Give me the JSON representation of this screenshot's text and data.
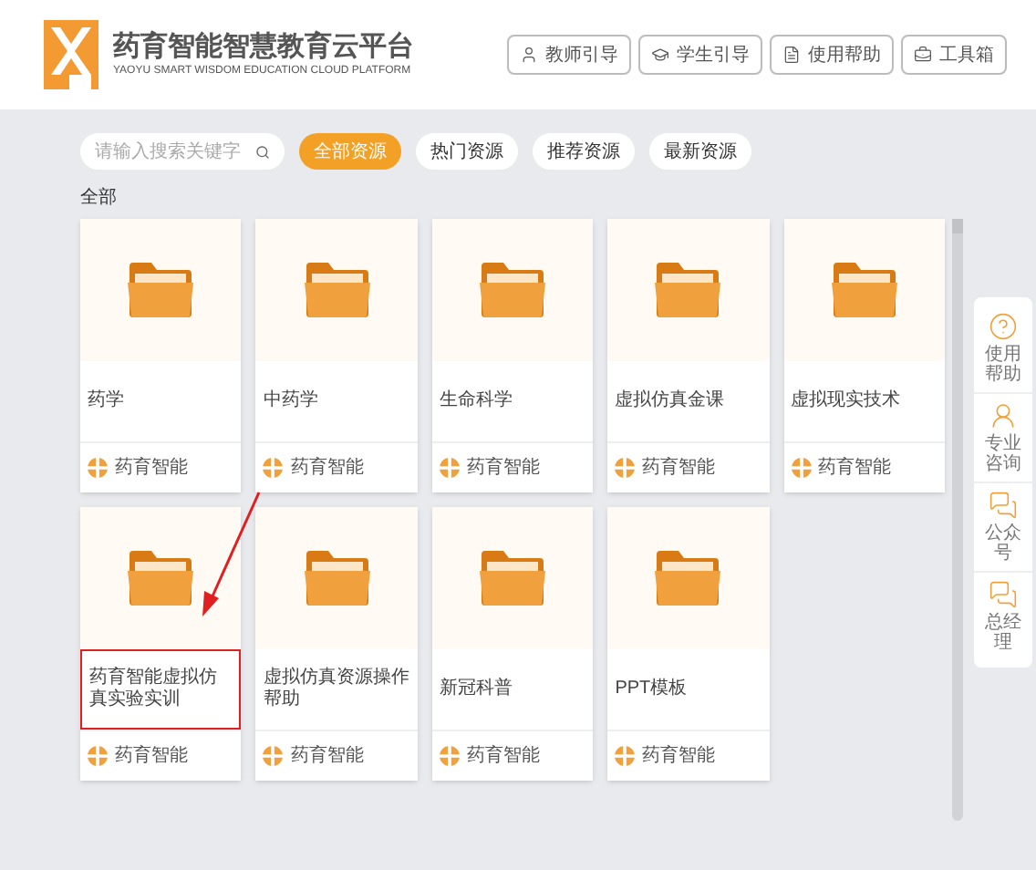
{
  "header": {
    "title": "药育智能智慧教育云平台",
    "subtitle": "YAOYU SMART WISDOM EDUCATION CLOUD PLATFORM",
    "buttons": [
      {
        "label": "教师引导"
      },
      {
        "label": "学生引导"
      },
      {
        "label": "使用帮助"
      },
      {
        "label": "工具箱"
      }
    ]
  },
  "search": {
    "placeholder": "请输入搜索关键字"
  },
  "filters": [
    {
      "label": "全部资源",
      "selected": true
    },
    {
      "label": "热门资源",
      "selected": false
    },
    {
      "label": "推荐资源",
      "selected": false
    },
    {
      "label": "最新资源",
      "selected": false
    }
  ],
  "section_title": "全部",
  "cards": [
    {
      "title": "药学",
      "author": "药育智能",
      "highlighted": false
    },
    {
      "title": "中药学",
      "author": "药育智能",
      "highlighted": false
    },
    {
      "title": "生命科学",
      "author": "药育智能",
      "highlighted": false
    },
    {
      "title": "虚拟仿真金课",
      "author": "药育智能",
      "highlighted": false
    },
    {
      "title": "虚拟现实技术",
      "author": "药育智能",
      "highlighted": false
    },
    {
      "title": "药育智能虚拟仿真实验实训",
      "author": "药育智能",
      "highlighted": true
    },
    {
      "title": "虚拟仿真资源操作帮助",
      "author": "药育智能",
      "highlighted": false
    },
    {
      "title": "新冠科普",
      "author": "药育智能",
      "highlighted": false
    },
    {
      "title": "PPT模板",
      "author": "药育智能",
      "highlighted": false
    }
  ],
  "side_panel": [
    {
      "label": "使用帮助"
    },
    {
      "label": "专业咨询"
    },
    {
      "label": "公众号"
    },
    {
      "label": "总经理"
    }
  ]
}
